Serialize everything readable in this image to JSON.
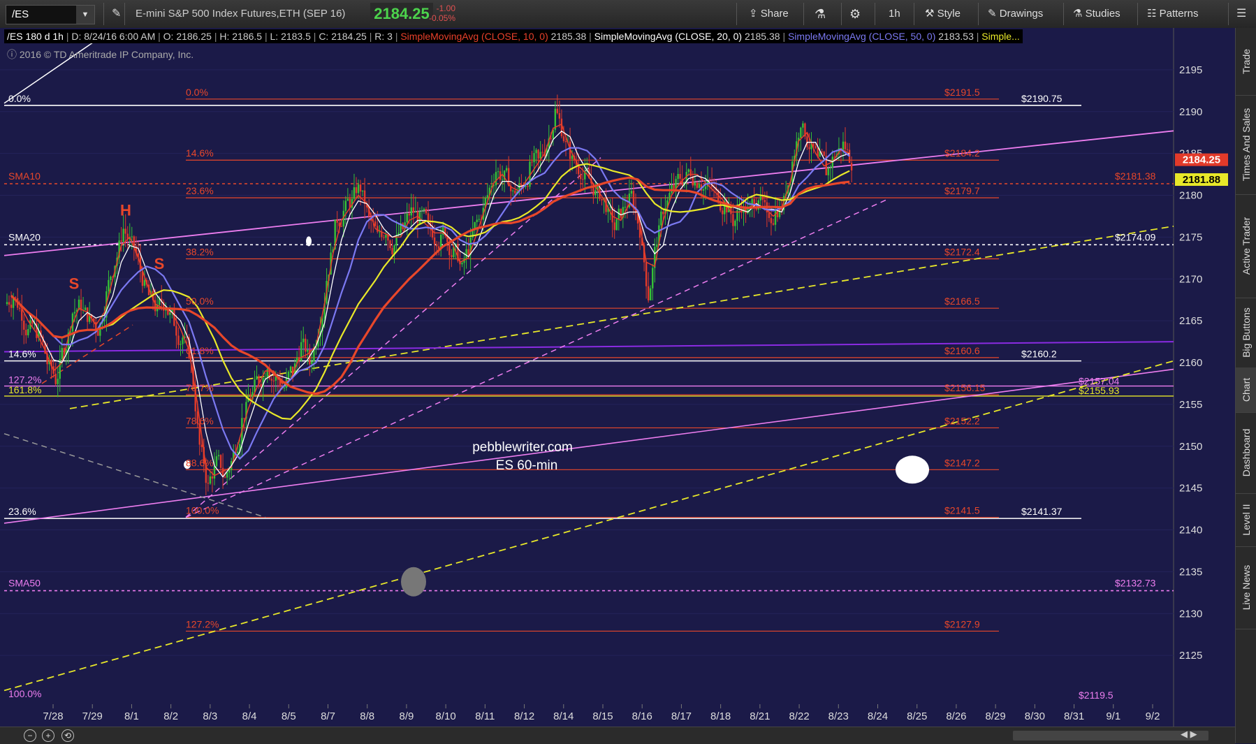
{
  "toolbar": {
    "symbol": "/ES",
    "instrument_desc": "E-mini S&P 500 Index Futures,ETH (SEP 16)",
    "last_price": "2184.25",
    "change": "-1.00",
    "change_pct": "-0.05%",
    "share_label": "Share",
    "timeframe_label": "1h",
    "style_label": "Style",
    "drawings_label": "Drawings",
    "studies_label": "Studies",
    "patterns_label": "Patterns"
  },
  "info_bar": {
    "symbol_tf": "/ES 180 d 1h",
    "date": "D: 8/24/16 6:00 AM",
    "open": "O: 2186.25",
    "high": "H: 2186.5",
    "low": "L: 2183.5",
    "close": "C: 2184.25",
    "range": "R: 3",
    "sma10_label": "SimpleMovingAvg (CLOSE, 10, 0)",
    "sma10_value": "2185.38",
    "sma20_label": "SimpleMovingAvg (CLOSE, 20, 0)",
    "sma20_value": "2185.38",
    "sma50_label": "SimpleMovingAvg (CLOSE, 50, 0)",
    "sma50_value": "2183.53",
    "more_label": "Simple..."
  },
  "copyright": "2016 © TD Ameritrade IP Company, Inc.",
  "watermark": {
    "line1": "pebblewriter.com",
    "line2": "ES 60-min"
  },
  "side_tabs": [
    "Trade",
    "Times And Sales",
    "Active Trader",
    "Big Buttons",
    "Chart",
    "Dashboard",
    "Level II",
    "Live News"
  ],
  "colors": {
    "background": "#1b1a48",
    "fib": "#e8472a",
    "sma10": "#e8402a",
    "sma20": "#ffffff",
    "sma50": "#7b79f2",
    "sma200": "#e8e829",
    "up_candle": "#36c236",
    "down_candle": "#e23a2a",
    "trend_pink": "#ee7ef0",
    "trend_yellow": "#e8e829",
    "purple": "#8a2be2"
  },
  "chart_data": {
    "type": "candlestick",
    "ylim": [
      2119,
      2199
    ],
    "y_ticks": [
      2125,
      2130,
      2135,
      2140,
      2145,
      2150,
      2155,
      2160,
      2165,
      2170,
      2175,
      2180,
      2185,
      2190,
      2195
    ],
    "x_tick_labels": [
      "7/28",
      "7/29",
      "8/1",
      "8/2",
      "8/3",
      "8/4",
      "8/5",
      "8/7",
      "8/8",
      "8/9",
      "8/10",
      "8/11",
      "8/12",
      "8/14",
      "8/15",
      "8/16",
      "8/17",
      "8/18",
      "8/21",
      "8/22",
      "8/23",
      "8/24",
      "8/25",
      "8/26",
      "8/29",
      "8/30",
      "8/31",
      "9/1",
      "9/2"
    ],
    "price_tags": [
      {
        "label": "2184.25",
        "value": 2184.25,
        "bg": "#e23a2a",
        "fg": "#ffffff"
      },
      {
        "label": "2181.88",
        "value": 2181.88,
        "bg": "#e8e829",
        "fg": "#000000"
      }
    ],
    "fib_levels": [
      {
        "pct": "0.0%",
        "price": "$2191.5",
        "value": 2191.5
      },
      {
        "pct": "14.6%",
        "price": "$2184.2",
        "value": 2184.2
      },
      {
        "pct": "23.6%",
        "price": "$2179.7",
        "value": 2179.7
      },
      {
        "pct": "38.2%",
        "price": "$2172.4",
        "value": 2172.4
      },
      {
        "pct": "50.0%",
        "price": "$2166.5",
        "value": 2166.5
      },
      {
        "pct": "61.8%",
        "price": "$2160.6",
        "value": 2160.6
      },
      {
        "pct": "70.7%",
        "price": "$2156.15",
        "value": 2156.15
      },
      {
        "pct": "78.6%",
        "price": "$2152.2",
        "value": 2152.2
      },
      {
        "pct": "88.6%",
        "price": "$2147.2",
        "value": 2147.2
      },
      {
        "pct": "100.0%",
        "price": "$2141.5",
        "value": 2141.5
      },
      {
        "pct": "127.2%",
        "price": "$2127.9",
        "value": 2127.9
      }
    ],
    "white_levels": [
      {
        "left_label": "0.0%",
        "right_label": "$2190.75",
        "value": 2190.75
      },
      {
        "left_label": "14.6%",
        "right_label": "$2160.2",
        "value": 2160.2
      },
      {
        "left_label": "23.6%",
        "right_label": "$2141.37",
        "value": 2141.37
      }
    ],
    "sma_levels": [
      {
        "label": "SMA10",
        "price": "$2181.38",
        "value": 2181.38,
        "color": "#e8472a"
      },
      {
        "label": "SMA20",
        "price": "$2174.09",
        "value": 2174.09,
        "color": "#ffffff"
      },
      {
        "label": "SMA50",
        "price": "$2132.73",
        "value": 2132.73,
        "color": "#ee7ef0"
      }
    ],
    "misc_levels": [
      {
        "label": "127.2%",
        "value": 2157.2,
        "color": "#ee7ef0"
      },
      {
        "label": "161.8%",
        "value": 2156.0,
        "color": "#e8e829"
      },
      {
        "label": "100.0%",
        "value": 2120.0,
        "color": "#ee7ef0"
      }
    ],
    "right_labels": [
      {
        "label": "$2157.04",
        "value": 2157.04,
        "color": "#ee7ef0"
      },
      {
        "label": "$2155.93",
        "value": 2155.93,
        "color": "#e8e829"
      },
      {
        "label": "$2119.5",
        "value": 2119.5,
        "color": "#ee7ef0"
      }
    ],
    "pattern_labels": [
      "S",
      "H",
      "S"
    ],
    "close_series": [
      2168,
      2166,
      2164,
      2163,
      2160,
      2158,
      2162,
      2166,
      2167,
      2165,
      2164,
      2168,
      2172,
      2176,
      2174,
      2171,
      2168,
      2166,
      2167,
      2165,
      2163,
      2160,
      2150,
      2145,
      2148,
      2146,
      2149,
      2153,
      2156,
      2158,
      2160,
      2158,
      2157,
      2159,
      2162,
      2160,
      2164,
      2170,
      2176,
      2178,
      2179,
      2181,
      2177,
      2175,
      2176,
      2174,
      2176,
      2178,
      2177,
      2176,
      2175,
      2176,
      2173,
      2171,
      2174,
      2177,
      2180,
      2183,
      2182,
      2180,
      2181,
      2183,
      2184,
      2186,
      2190,
      2187,
      2184,
      2183,
      2182,
      2180,
      2179,
      2176,
      2178,
      2180,
      2176,
      2168,
      2175,
      2179,
      2181,
      2182,
      2183,
      2182,
      2181,
      2180,
      2179,
      2177,
      2179,
      2178,
      2180,
      2177,
      2178,
      2179,
      2184,
      2189,
      2186,
      2184,
      2183,
      2185,
      2186,
      2184
    ]
  }
}
